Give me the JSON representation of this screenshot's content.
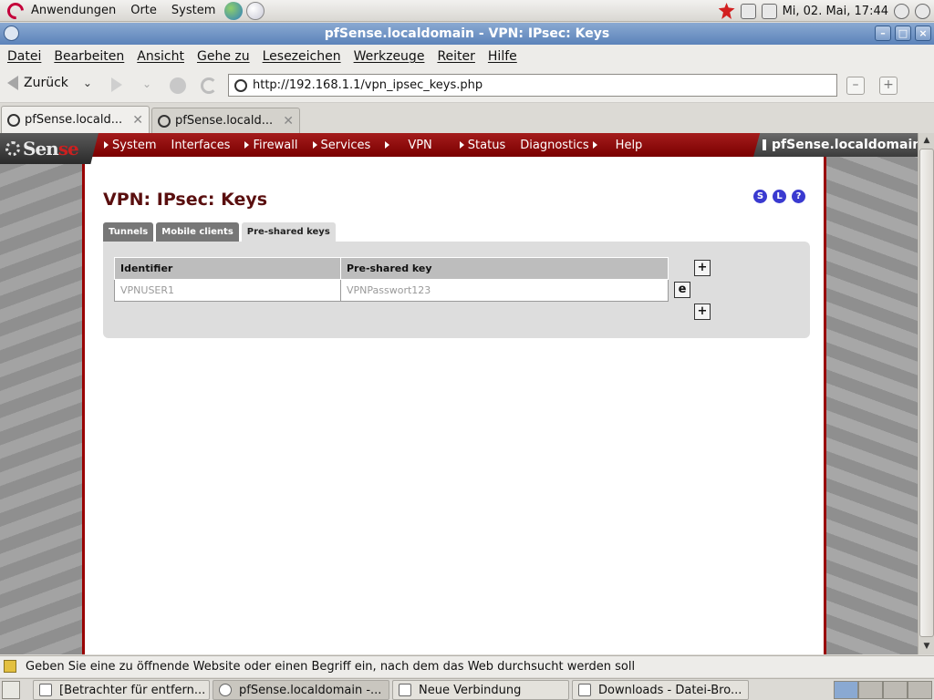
{
  "panel_top": {
    "menus": [
      "Anwendungen",
      "Orte",
      "System"
    ],
    "clock": "Mi, 02. Mai, 17:44"
  },
  "window": {
    "title": "pfSense.localdomain - VPN: IPsec: Keys"
  },
  "menubar": [
    "Datei",
    "Bearbeiten",
    "Ansicht",
    "Gehe zu",
    "Lesezeichen",
    "Werkzeuge",
    "Reiter",
    "Hilfe"
  ],
  "toolbar": {
    "back_label": "Zurück",
    "url": "http://192.168.1.1/vpn_ipsec_keys.php"
  },
  "tabs": [
    {
      "label": "pfSense.locald..."
    },
    {
      "label": "pfSense.locald..."
    }
  ],
  "pfsense": {
    "logo": {
      "pf": "pf",
      "sen": "Sen",
      "se": "se"
    },
    "nav": [
      "System",
      "Interfaces",
      "Firewall",
      "Services",
      "",
      "VPN",
      "Status",
      "Diagnostics",
      "Help"
    ],
    "hostname": "pfSense.localdomain",
    "page_title": "VPN: IPsec: Keys",
    "quick_icons": [
      "S",
      "L",
      "?"
    ],
    "subtabs": [
      "Tunnels",
      "Mobile clients",
      "Pre-shared keys"
    ],
    "table": {
      "headers": [
        "Identifier",
        "Pre-shared key"
      ],
      "rows": [
        {
          "identifier": "VPNUSER1",
          "key": "VPNPasswort123"
        }
      ]
    }
  },
  "statusbar": {
    "text": "Geben Sie eine zu öffnende Website oder einen Begriff ein, nach dem das Web durchsucht werden soll"
  },
  "taskbar": [
    {
      "label": "[Betrachter für entfern..."
    },
    {
      "label": "pfSense.localdomain -..."
    },
    {
      "label": "Neue Verbindung"
    },
    {
      "label": "Downloads - Datei-Bro..."
    }
  ]
}
